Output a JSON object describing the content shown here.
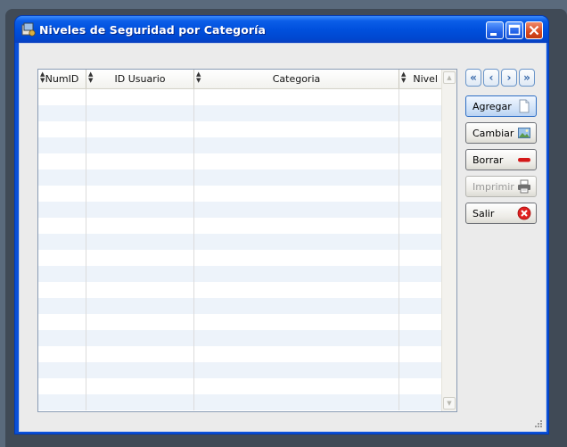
{
  "window": {
    "title": "Niveles de Seguridad por Categoría"
  },
  "grid": {
    "columns": [
      {
        "label": "NumID"
      },
      {
        "label": "ID Usuario"
      },
      {
        "label": "Categoria"
      },
      {
        "label": "Nivel"
      }
    ],
    "rows": []
  },
  "navigation": {
    "first": "«",
    "prev": "‹",
    "next": "›",
    "last": "»"
  },
  "actions": {
    "add": "Agregar",
    "change": "Cambiar",
    "delete": "Borrar",
    "print": "Imprimir",
    "exit": "Salir"
  },
  "colors": {
    "titlebar": "#0050dd",
    "row_alt": "#edf3fa",
    "primary_button": "#cde0f7",
    "close_red": "#e02020"
  }
}
